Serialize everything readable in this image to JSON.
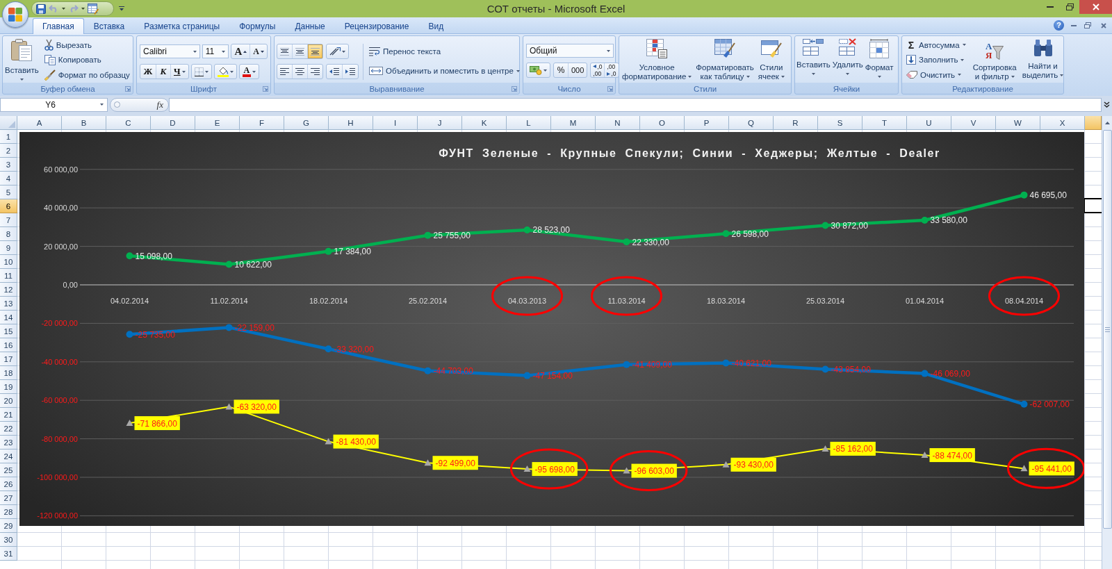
{
  "window": {
    "title": "СОТ отчеты - Microsoft Excel"
  },
  "quick_access": {
    "undo": {
      "disabled": true
    },
    "redo": {
      "disabled": true
    }
  },
  "tabs": [
    {
      "label": "Главная",
      "selected": true
    },
    {
      "label": "Вставка",
      "selected": false
    },
    {
      "label": "Разметка страницы",
      "selected": false
    },
    {
      "label": "Формулы",
      "selected": false
    },
    {
      "label": "Данные",
      "selected": false
    },
    {
      "label": "Рецензирование",
      "selected": false
    },
    {
      "label": "Вид",
      "selected": false
    }
  ],
  "help": "?",
  "ribbon": {
    "clipboard": {
      "label": "Буфер обмена",
      "launcher": true,
      "paste": "Вставить",
      "cut": "Вырезать",
      "copy": "Копировать",
      "format_painter": "Формат по образцу"
    },
    "font": {
      "label": "Шрифт",
      "launcher": true,
      "font_name": "Calibri",
      "font_size": "11",
      "grow": "A",
      "shrink": "A",
      "bold": "Ж",
      "italic": "К",
      "underline": "Ч",
      "font_color": "A"
    },
    "alignment": {
      "label": "Выравнивание",
      "launcher": true,
      "vertical": [
        {
          "selected": false
        },
        {
          "selected": false
        },
        {
          "selected": true
        }
      ],
      "wrap_text": "Перенос текста",
      "merge": "Объединить и поместить в центре"
    },
    "number": {
      "label": "Число",
      "launcher": true,
      "format": "Общий",
      "percent": "%",
      "thousands": "000",
      "increase_decimal": [
        ",0",
        ",00"
      ],
      "decrease_decimal": [
        ",00",
        ",0"
      ]
    },
    "styles": {
      "label": "Стили",
      "launcher": false,
      "conditional": [
        "Условное",
        "форматирование"
      ],
      "as_table": [
        "Форматировать",
        "как таблицу"
      ],
      "cell_styles": [
        "Стили",
        "ячеек"
      ]
    },
    "cells": {
      "label": "Ячейки",
      "launcher": false,
      "insert": "Вставить",
      "delete": "Удалить",
      "format": "Формат"
    },
    "editing": {
      "label": "Редактирование",
      "launcher": false,
      "autosum_symbol": "Σ",
      "autosum": "Автосумма",
      "fill": "Заполнить",
      "clear": "Очистить",
      "sort_letters": [
        "А",
        "Я"
      ],
      "sort_filter": [
        "Сортировка",
        "и фильтр"
      ],
      "find": [
        "Найти и",
        "выделить"
      ]
    }
  },
  "formula_bar": {
    "name_box": "Y6",
    "function_button": "fx"
  },
  "sheet": {
    "columns": [
      {
        "label": "A",
        "selected": false
      },
      {
        "label": "B",
        "selected": false
      },
      {
        "label": "C",
        "selected": false
      },
      {
        "label": "D",
        "selected": false
      },
      {
        "label": "E",
        "selected": false
      },
      {
        "label": "F",
        "selected": false
      },
      {
        "label": "G",
        "selected": false
      },
      {
        "label": "H",
        "selected": false
      },
      {
        "label": "I",
        "selected": false
      },
      {
        "label": "J",
        "selected": false
      },
      {
        "label": "K",
        "selected": false
      },
      {
        "label": "L",
        "selected": false
      },
      {
        "label": "M",
        "selected": false
      },
      {
        "label": "N",
        "selected": false
      },
      {
        "label": "O",
        "selected": false
      },
      {
        "label": "P",
        "selected": false
      },
      {
        "label": "Q",
        "selected": false
      },
      {
        "label": "R",
        "selected": false
      },
      {
        "label": "S",
        "selected": false
      },
      {
        "label": "T",
        "selected": false
      },
      {
        "label": "U",
        "selected": false
      },
      {
        "label": "V",
        "selected": false
      },
      {
        "label": "W",
        "selected": false
      },
      {
        "label": "X",
        "selected": false
      },
      {
        "selected": true
      }
    ],
    "rows": [
      {
        "label": "1",
        "selected": false
      },
      {
        "label": "2",
        "selected": false
      },
      {
        "label": "3",
        "selected": false
      },
      {
        "label": "4",
        "selected": false
      },
      {
        "label": "5",
        "selected": false
      },
      {
        "label": "6",
        "selected": true
      },
      {
        "label": "7",
        "selected": false
      },
      {
        "label": "8",
        "selected": false
      },
      {
        "label": "9",
        "selected": false
      },
      {
        "label": "10",
        "selected": false
      },
      {
        "label": "11",
        "selected": false
      },
      {
        "label": "12",
        "selected": false
      },
      {
        "label": "13",
        "selected": false
      },
      {
        "label": "14",
        "selected": false
      },
      {
        "label": "15",
        "selected": false
      },
      {
        "label": "16",
        "selected": false
      },
      {
        "label": "17",
        "selected": false
      },
      {
        "label": "18",
        "selected": false
      },
      {
        "label": "19",
        "selected": false
      },
      {
        "label": "20",
        "selected": false
      },
      {
        "label": "21",
        "selected": false
      },
      {
        "label": "22",
        "selected": false
      },
      {
        "label": "23",
        "selected": false
      },
      {
        "label": "24",
        "selected": false
      },
      {
        "label": "25",
        "selected": false
      },
      {
        "label": "26",
        "selected": false
      },
      {
        "label": "27",
        "selected": false
      },
      {
        "label": "28",
        "selected": false
      },
      {
        "label": "29",
        "selected": false
      },
      {
        "label": "30",
        "selected": false
      },
      {
        "label": "31",
        "selected": false
      }
    ],
    "chart_data": {
      "type": "line",
      "title": "ФУНТ Зеленые - Крупные Спекули; Синии - Хеджеры; Желтые - Dealer",
      "categories": [
        "04.02.2014",
        "11.02.2014",
        "18.02.2014",
        "25.02.2014",
        "04.03.2013",
        "11.03.2014",
        "18.03.2014",
        "25.03.2014",
        "01.04.2014",
        "08.04.2014"
      ],
      "series": [
        {
          "marker": "circle",
          "color": "#00b050",
          "values": [
            15098,
            10622,
            17384,
            25755,
            28523,
            22330,
            26598,
            30872,
            33580,
            46695
          ],
          "value_labels": [
            "15 098,00",
            "10 622,00",
            "17 384,00",
            "25 755,00",
            "28 523,00",
            "22 330,00",
            "26 598,00",
            "30 872,00",
            "33 580,00",
            "46 695,00"
          ]
        },
        {
          "marker": "circle",
          "color": "#0070c0",
          "values": [
            -25735,
            -22159,
            -33320,
            -44703,
            -47154,
            -41409,
            -40621,
            -43854,
            -46069,
            -62007
          ],
          "value_labels": [
            "-25 735,00",
            "-22 159,00",
            "-33 320,00",
            "-44 703,00",
            "-47 154,00",
            "-41 409,00",
            "-40 621,00",
            "-43 854,00",
            "-46 069,00",
            "-62 007,00"
          ]
        },
        {
          "marker": "triangle",
          "color": "#ffff00",
          "values": [
            -71866,
            -63320,
            -81430,
            -92499,
            -95698,
            -96603,
            -93430,
            -85162,
            -88474,
            -95441
          ],
          "value_labels": [
            "-71 866,00",
            "-63 320,00",
            "-81 430,00",
            "-92 499,00",
            "-95 698,00",
            "-96 603,00",
            "-93 430,00",
            "-85 162,00",
            "-88 474,00",
            "-95 441,00"
          ]
        }
      ],
      "ylim": [
        -120000,
        60000
      ],
      "yticks": [
        {
          "value": 60000,
          "label": "60 000,00"
        },
        {
          "value": 40000,
          "label": "40 000,00"
        },
        {
          "value": 20000,
          "label": "20 000,00"
        },
        {
          "value": 0,
          "label": "0,00"
        },
        {
          "value": -20000,
          "label": "-20 000,00"
        },
        {
          "value": -40000,
          "label": "-40 000,00"
        },
        {
          "value": -60000,
          "label": "-60 000,00"
        },
        {
          "value": -80000,
          "label": "-80 000,00"
        },
        {
          "value": -100000,
          "label": "-100 000,00"
        },
        {
          "value": -120000,
          "label": "-120 000,00"
        }
      ],
      "grid": true,
      "data_labels": true,
      "annotations": [
        {
          "x": "04.03.2013"
        },
        {
          "x": "11.03.2014"
        },
        {
          "x": "08.04.2014"
        },
        {
          "x": "04.03.2013",
          "y": "-95 698,00"
        },
        {
          "x": "11.03.2014",
          "y": "-96 603,00"
        },
        {
          "x": "08.04.2014",
          "y": "-95 441,00"
        }
      ]
    }
  }
}
